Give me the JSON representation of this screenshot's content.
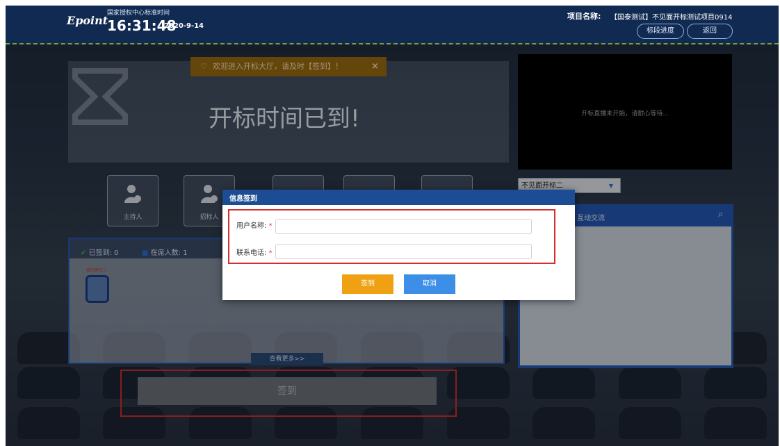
{
  "header": {
    "logo": "Epoint",
    "time_label": "国家授权中心标准时间",
    "time": "16:31:48",
    "date": "2020-9-14",
    "project_label": "项目名称:",
    "project_name": "【国泰测试】不见面开标测试项目0914",
    "progress_button": "标段进度",
    "back_button": "返回"
  },
  "notice": {
    "text": "欢迎进入开标大厅，请及时【签到】！",
    "close": "×"
  },
  "banner": {
    "title": "开标时间已到!"
  },
  "video": {
    "message": "开标直播未开始，请耐心等待..."
  },
  "section_select": {
    "value": "不见面开标二"
  },
  "roles": [
    {
      "label": "主持人"
    },
    {
      "label": "招标人"
    }
  ],
  "seat_panel": {
    "signed": "已签到: 0",
    "online": "在席人数: 1",
    "seat_tag": "我的座位:1",
    "more": "查看更多>>"
  },
  "chat": {
    "title": "互动交流"
  },
  "modal": {
    "title": "信息签到",
    "username_label": "用户名称:",
    "phone_label": "联系电话:",
    "required_mark": "*",
    "username_value": "",
    "phone_value": "",
    "confirm": "签到",
    "cancel": "取消"
  },
  "bottom": {
    "sign_button": "签到"
  },
  "colors": {
    "header_bg": "#102a52",
    "accent_orange": "#f0a113",
    "accent_blue": "#3d8ee6",
    "highlight_red": "#d32f2f"
  }
}
